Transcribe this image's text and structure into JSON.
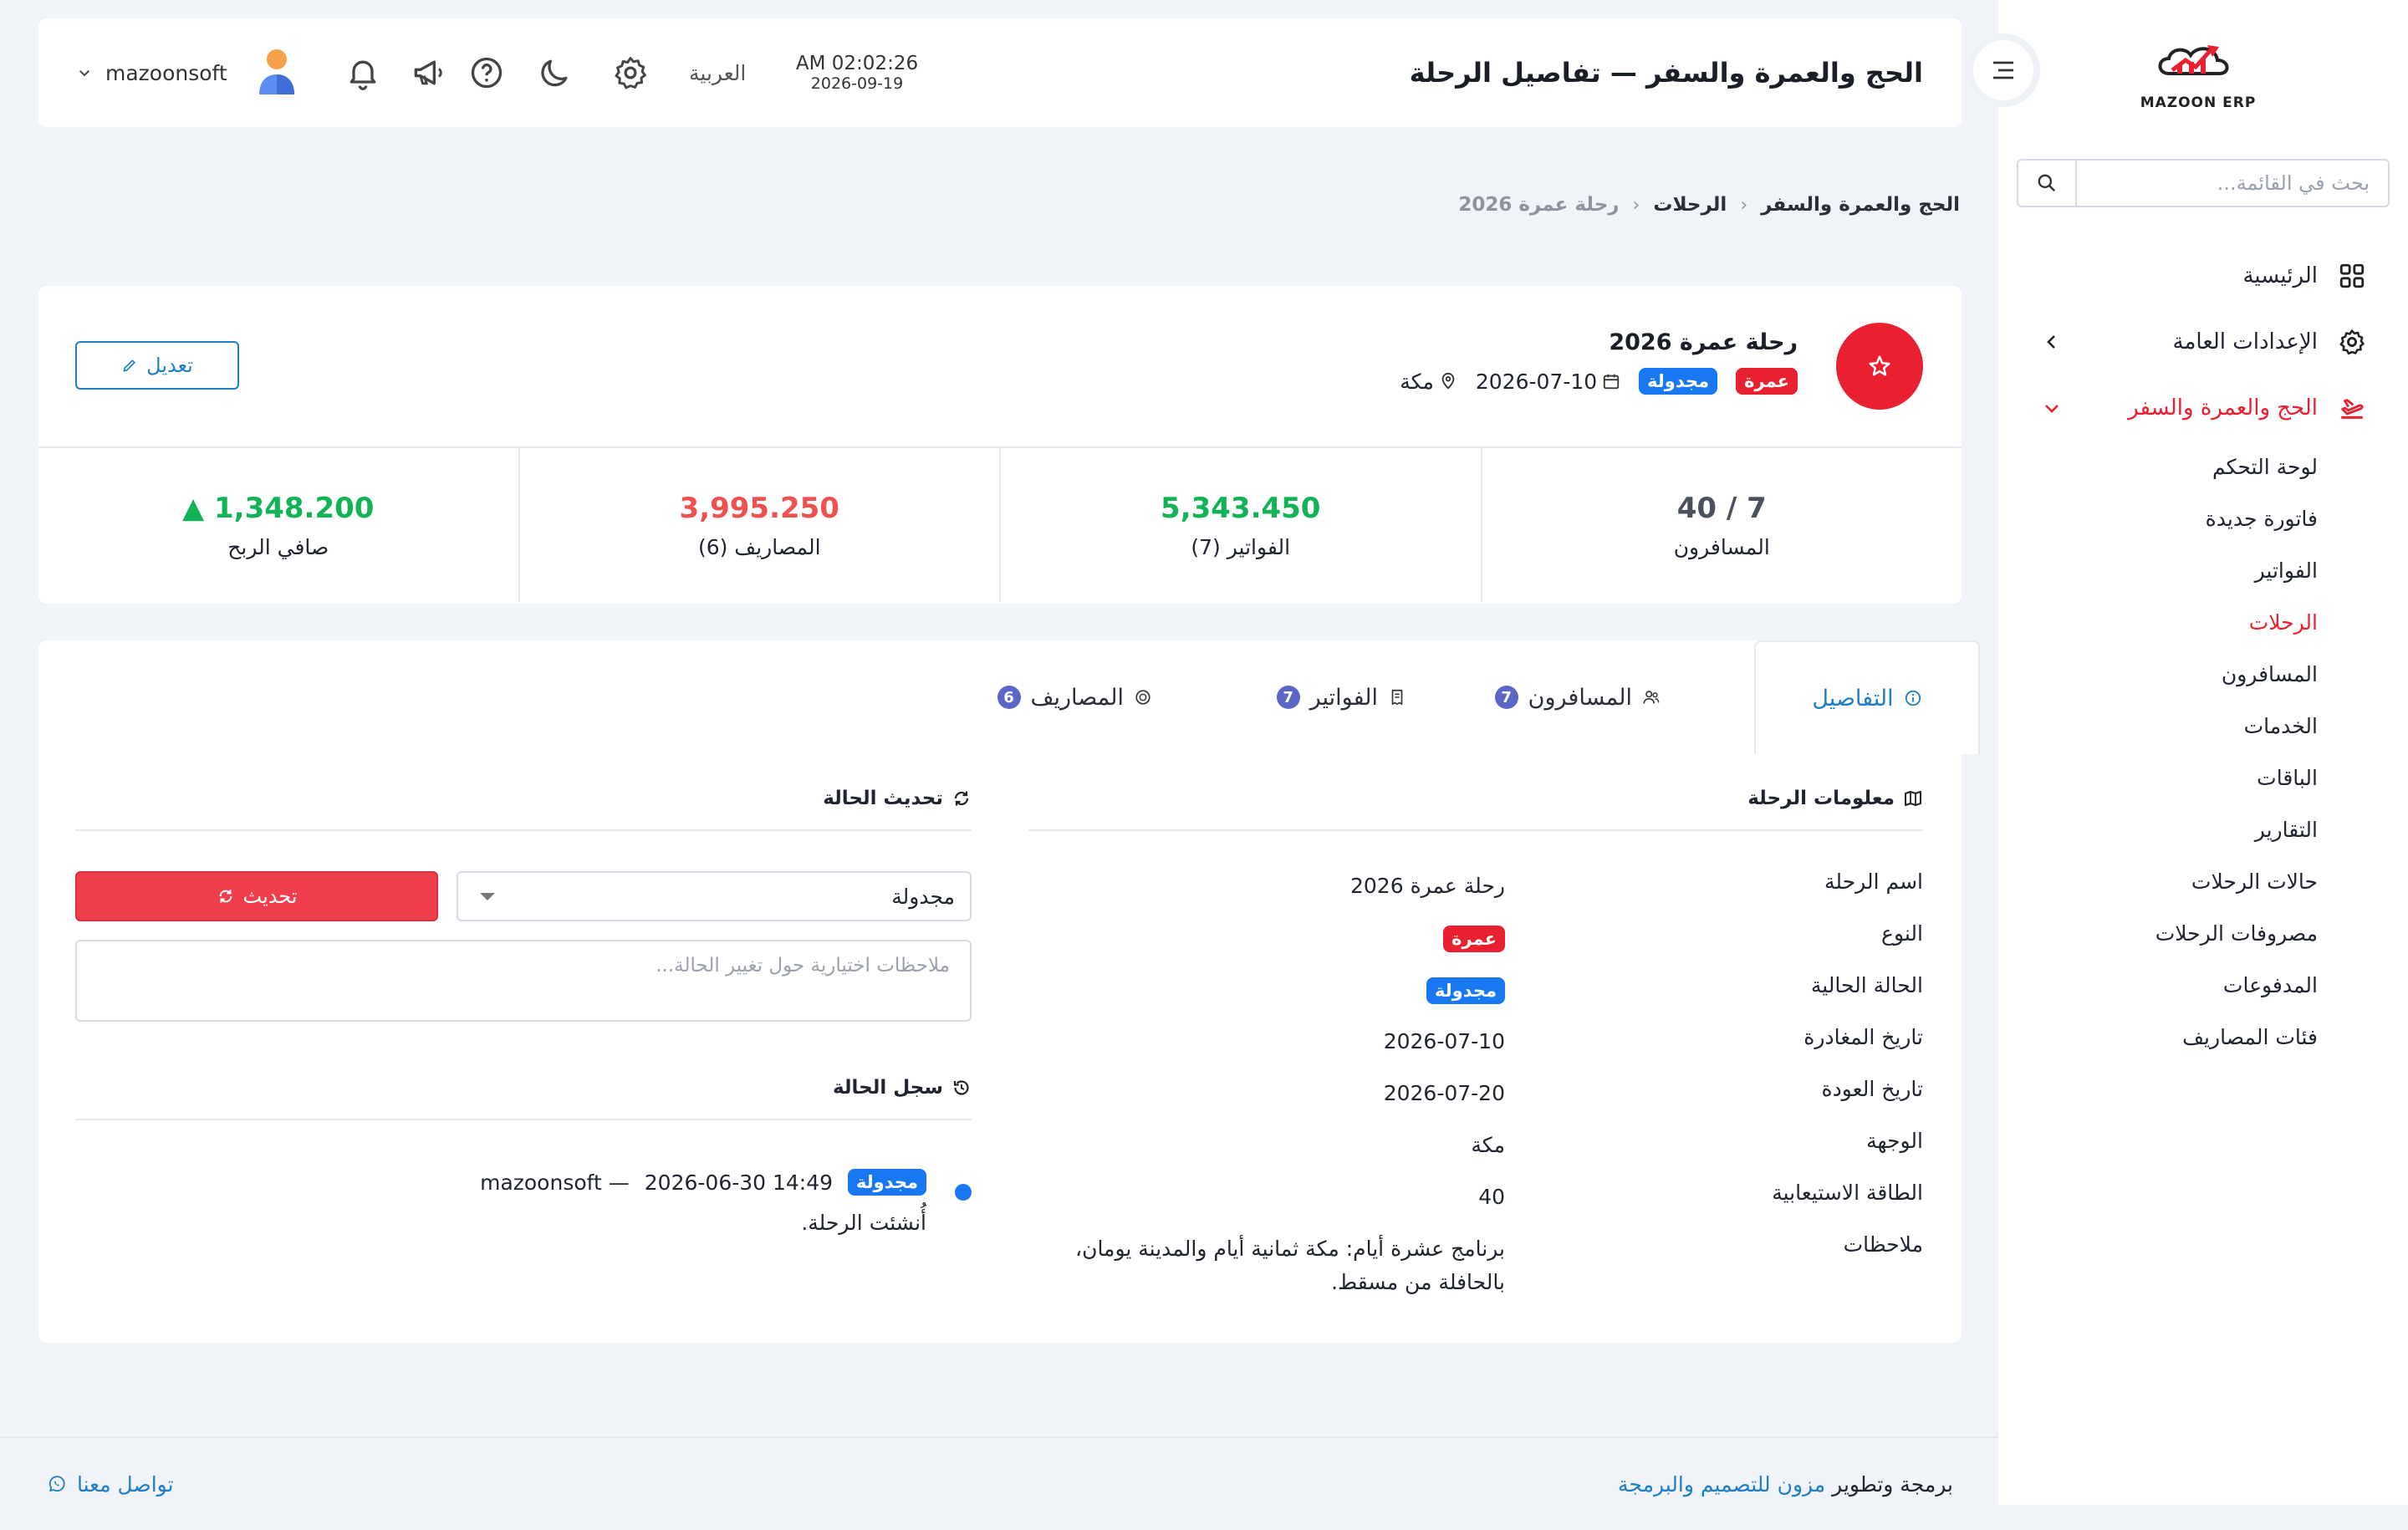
{
  "brand": {
    "name": "MAZOON ERP",
    "accent": "#e8202f"
  },
  "sidebar": {
    "search_placeholder": "بحث في القائمة...",
    "items": [
      {
        "label": "الرئيسية",
        "icon": "grid-icon"
      },
      {
        "label": "الإعدادات العامة",
        "icon": "gear-icon"
      },
      {
        "label": "الحج والعمرة والسفر",
        "icon": "plane-icon"
      }
    ],
    "sub_items": [
      "لوحة التحكم",
      "فاتورة جديدة",
      "الفواتير",
      "الرحلات",
      "المسافرون",
      "الخدمات",
      "الباقات",
      "التقارير",
      "حالات الرحلات",
      "مصروفات الرحلات",
      "المدفوعات",
      "فئات المصاريف"
    ]
  },
  "header": {
    "title": "الحج والعمرة والسفر — تفاصيل الرحلة",
    "time": "AM 02:02:26",
    "date": "2026-09-19",
    "language": "العربية",
    "username": "mazoonsoft"
  },
  "breadcrumb": [
    "الحج والعمرة والسفر",
    "الرحلات",
    "رحلة عمرة 2026"
  ],
  "trip": {
    "name": "رحلة عمرة 2026",
    "type_badge": "عمرة",
    "status_badge": "مجدولة",
    "date": "2026-07-10",
    "destination": "مكة",
    "edit_label": "تعديل"
  },
  "stats": [
    {
      "value": "40 / 7",
      "label": "المسافرون"
    },
    {
      "value": "5,343.450",
      "label": "الفواتير (7)"
    },
    {
      "value": "3,995.250",
      "label": "المصاريف (6)"
    },
    {
      "value": "▲ 1,348.200",
      "label": "صافي الربح"
    }
  ],
  "tabs": [
    {
      "label": "التفاصيل"
    },
    {
      "label": "المسافرون",
      "count": "7"
    },
    {
      "label": "الفواتير",
      "count": "7"
    },
    {
      "label": "المصاريف",
      "count": "6"
    }
  ],
  "info": {
    "heading": "معلومات الرحلة",
    "rows": [
      {
        "key": "اسم الرحلة",
        "value": "رحلة عمرة 2026"
      },
      {
        "key": "النوع",
        "value": "عمرة"
      },
      {
        "key": "الحالة الحالية",
        "value": "مجدولة"
      },
      {
        "key": "تاريخ المغادرة",
        "value": "2026-07-10"
      },
      {
        "key": "تاريخ العودة",
        "value": "2026-07-20"
      },
      {
        "key": "الوجهة",
        "value": "مكة"
      },
      {
        "key": "الطاقة الاستيعابية",
        "value": "40"
      },
      {
        "key": "ملاحظات",
        "value": "برنامج عشرة أيام: مكة ثمانية أيام والمدينة يومان، بالحافلة من مسقط."
      }
    ]
  },
  "status_update": {
    "heading": "تحديث الحالة",
    "selected": "مجدولة",
    "button": "تحديث",
    "notes_placeholder": "ملاحظات اختيارية حول تغيير الحالة..."
  },
  "status_log": {
    "heading": "سجل الحالة",
    "badge": "مجدولة",
    "datetime": "2026-06-30 14:49",
    "user": "— mazoonsoft",
    "note": "أُنشئت الرحلة."
  },
  "footer": {
    "credit_prefix": "برمجة وتطوير",
    "credit_link": "مزون للتصميم والبرمجة",
    "contact": "تواصل معنا"
  }
}
